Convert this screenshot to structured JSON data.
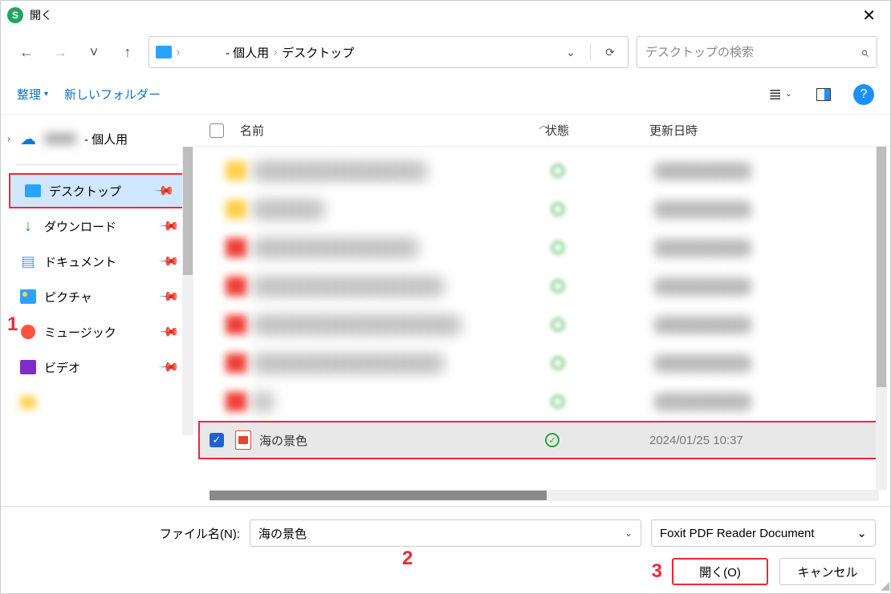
{
  "window": {
    "title": "開く"
  },
  "nav": {
    "back": "←",
    "forward": "→",
    "recent": "˅",
    "up": "↑"
  },
  "breadcrumb": {
    "seg1": "　　　",
    "seg2": "- 個人用",
    "seg3": "デスクトップ"
  },
  "addressbar": {
    "dropdown": "⌄",
    "refresh": "⟳"
  },
  "search": {
    "placeholder": "デスクトップの検索",
    "icon": "⌕"
  },
  "toolbar": {
    "organize": "整理",
    "newfolder": "新しいフォルダー",
    "view_caret": "⌄",
    "help": "?"
  },
  "sidebar": {
    "top": {
      "label": "- 個人用"
    },
    "items": [
      {
        "label": "デスクトップ",
        "selected": true
      },
      {
        "label": "ダウンロード"
      },
      {
        "label": "ドキュメント"
      },
      {
        "label": "ピクチャ"
      },
      {
        "label": "ミュージック"
      },
      {
        "label": "ビデオ"
      },
      {
        "label": "　　　　　"
      }
    ]
  },
  "columns": {
    "name": "名前",
    "state": "状態",
    "date": "更新日時"
  },
  "files": {
    "selected": {
      "name": "海の景色",
      "date": "2024/01/25 10:37"
    }
  },
  "footer": {
    "filename_label": "ファイル名(N):",
    "filename_value": "海の景色",
    "filter_value": "Foxit PDF Reader Document",
    "open": "開く(O)",
    "cancel": "キャンセル"
  },
  "annotations": {
    "a1": "1",
    "a2": "2",
    "a3": "3"
  }
}
